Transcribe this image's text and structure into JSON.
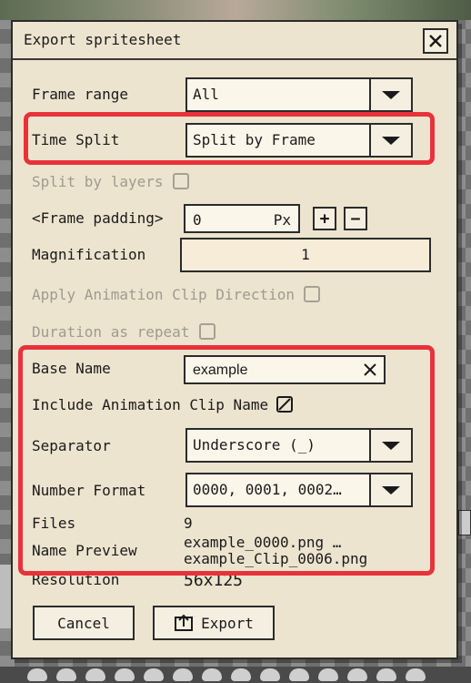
{
  "dialog": {
    "title": "Export spritesheet"
  },
  "frame_range": {
    "label": "Frame range",
    "value": "All"
  },
  "time_split": {
    "label": "Time Split",
    "value": "Split by Frame"
  },
  "split_by_layers": {
    "label": "Split by layers",
    "checked": false
  },
  "frame_padding": {
    "label": "<Frame padding>",
    "value": "0",
    "unit": "Px",
    "plus": "+",
    "minus": "−"
  },
  "magnification": {
    "label": "Magnification",
    "value": "1"
  },
  "apply_clip_direction": {
    "label": "Apply Animation Clip Direction",
    "checked": false
  },
  "duration_repeat": {
    "label": "Duration as repeat",
    "checked": false
  },
  "base_name": {
    "label": "Base Name",
    "value": "example"
  },
  "include_clip_name": {
    "label": "Include Animation Clip Name",
    "checked": true
  },
  "separator": {
    "label": "Separator",
    "value": "Underscore (_)"
  },
  "number_format": {
    "label": "Number Format",
    "value": "0000, 0001, 0002…"
  },
  "files": {
    "label": "Files",
    "value": "9"
  },
  "name_preview": {
    "label": "Name Preview",
    "line1": "example_0000.png …",
    "line2": "example_Clip_0006.png"
  },
  "resolution": {
    "label": "Resolution",
    "value": "56x125"
  },
  "buttons": {
    "cancel": "Cancel",
    "export": "Export"
  },
  "colors": {
    "highlight": "#e8323a",
    "panel": "#ede4cf"
  }
}
